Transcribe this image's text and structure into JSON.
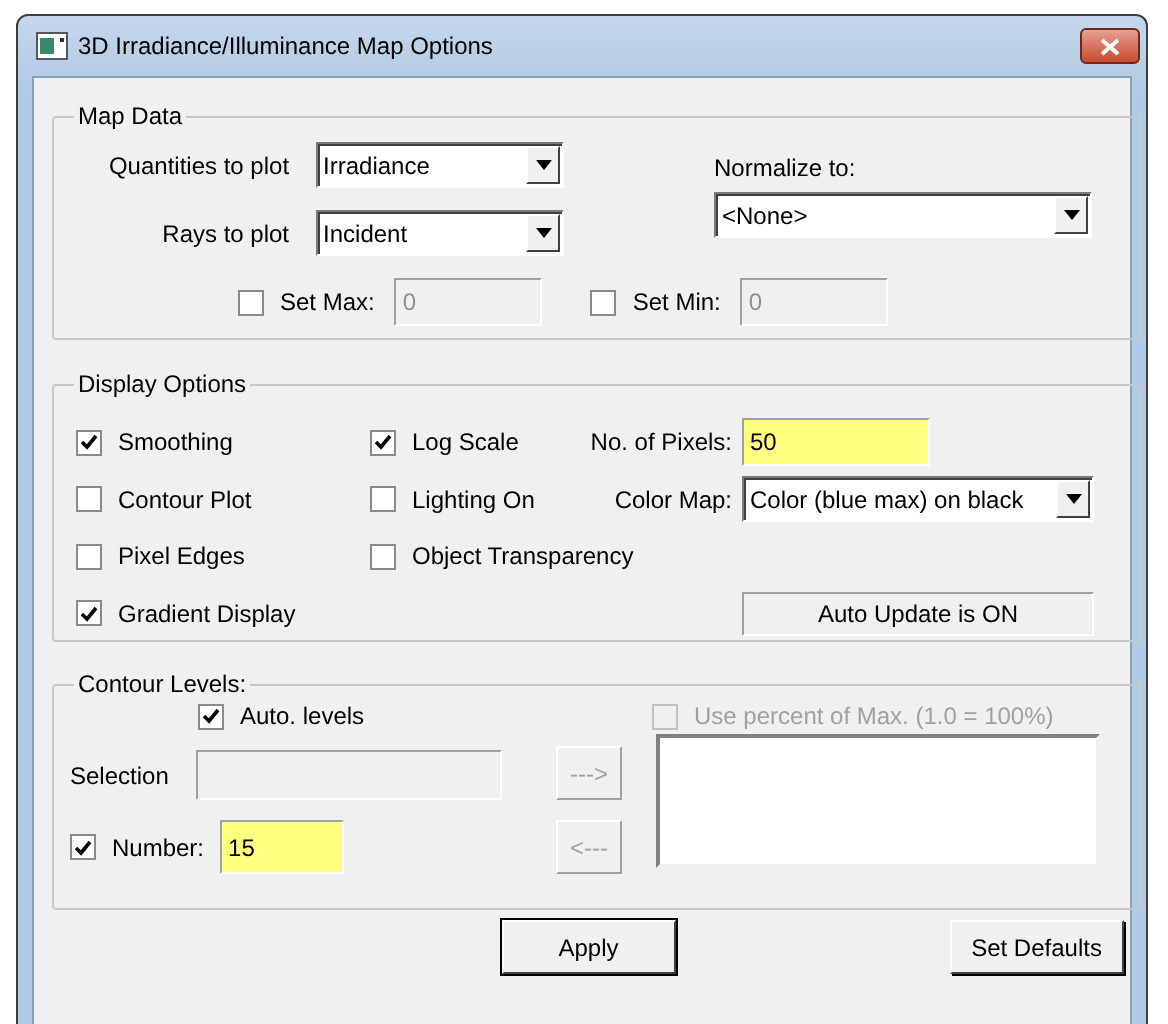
{
  "window": {
    "title": "3D Irradiance/Illuminance Map Options"
  },
  "map_data": {
    "legend": "Map Data",
    "quantities": {
      "label": "Quantities to plot",
      "value": "Irradiance"
    },
    "rays": {
      "label": "Rays to plot",
      "value": "Incident"
    },
    "normalize": {
      "label": "Normalize to:",
      "value": "<None>"
    },
    "set_max": {
      "label": "Set Max:",
      "checked": false,
      "value": "0",
      "disabled": true
    },
    "set_min": {
      "label": "Set Min:",
      "checked": false,
      "value": "0",
      "disabled": true
    }
  },
  "display_options": {
    "legend": "Display Options",
    "checkboxes": [
      {
        "label": "Smoothing",
        "checked": true
      },
      {
        "label": "Log Scale",
        "checked": true
      },
      {
        "label": "Contour Plot",
        "checked": false
      },
      {
        "label": "Lighting On",
        "checked": false
      },
      {
        "label": "Pixel Edges",
        "checked": false
      },
      {
        "label": "Object Transparency",
        "checked": false
      },
      {
        "label": "Gradient Display",
        "checked": true
      }
    ],
    "pixels": {
      "label": "No. of Pixels:",
      "value": "50"
    },
    "color_map": {
      "label": "Color Map:",
      "value": "Color (blue max) on black"
    },
    "status": "Auto Update is ON"
  },
  "contour_levels": {
    "legend": "Contour Levels:",
    "auto_levels": {
      "label": "Auto. levels",
      "checked": true,
      "disabled": false
    },
    "use_percent": {
      "label": "Use percent of Max. (1.0 = 100%)",
      "checked": false,
      "disabled": true
    },
    "selection": {
      "label": "Selection",
      "disabled": true
    },
    "arrow_buttons": [
      {
        "label": "--->",
        "disabled": true
      },
      {
        "label": "<---",
        "disabled": true
      }
    ],
    "number": {
      "label": "Number:",
      "checked": true,
      "value": "15"
    }
  },
  "buttons": [
    {
      "label": "Apply",
      "default": true
    },
    {
      "label": "Set Defaults",
      "default": false
    }
  ]
}
